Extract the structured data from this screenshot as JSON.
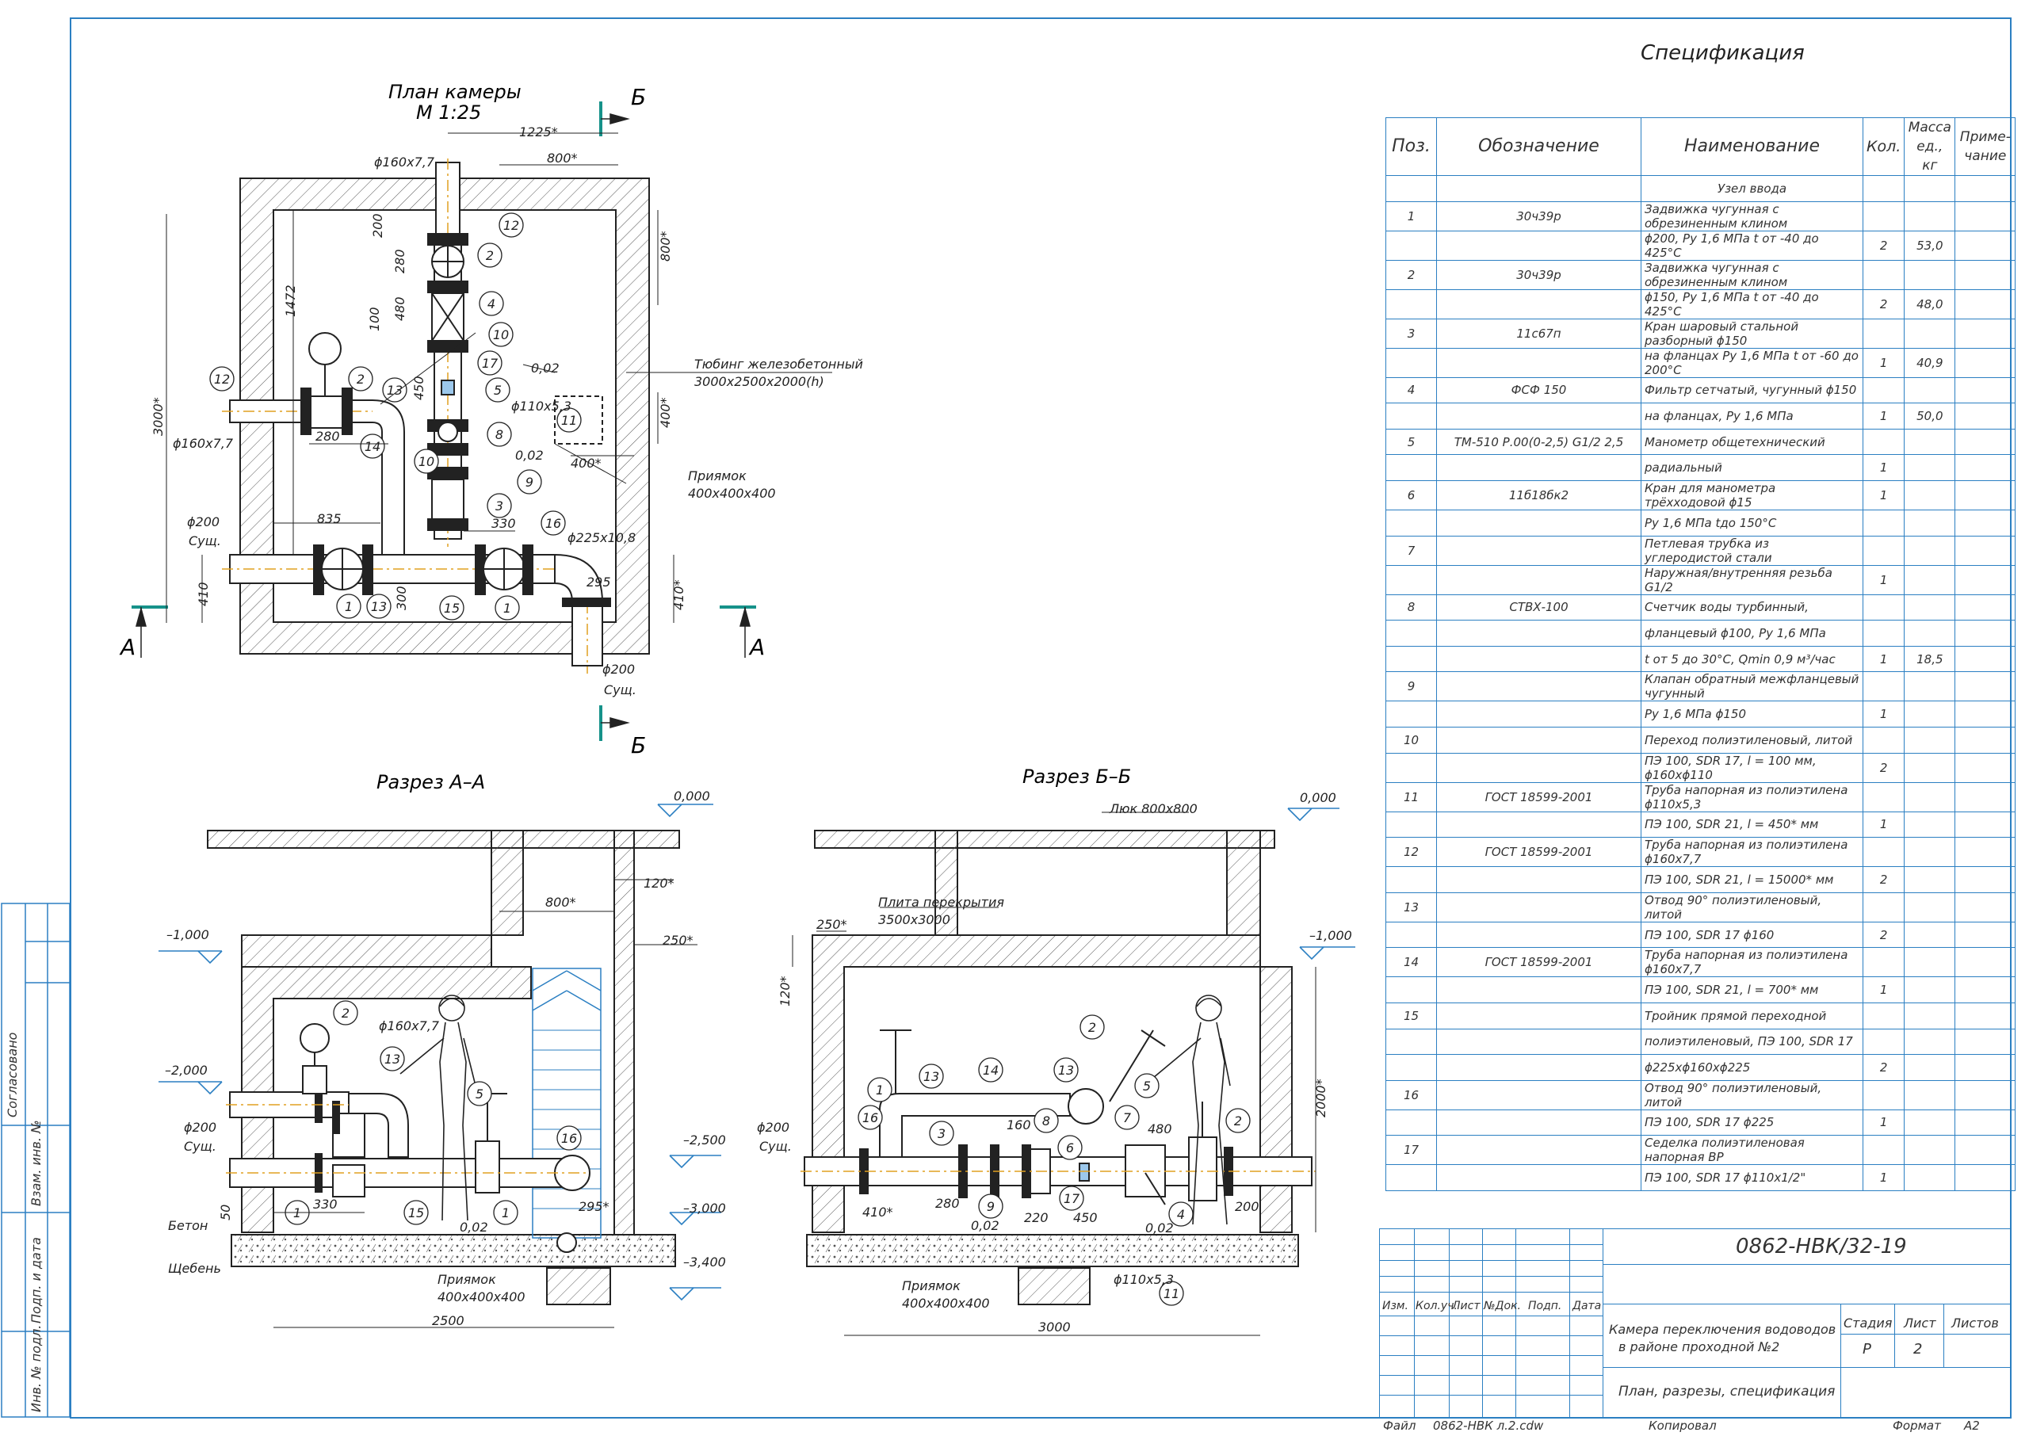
{
  "drawing": {
    "plan_title_1": "План камеры",
    "plan_title_2": "М 1:25",
    "section_aa": "Разрез А–А",
    "section_bb": "Разрез Б–Б",
    "cut_a": "А",
    "cut_b": "Б",
    "plan_labels": {
      "d160": "ϕ160x7,7",
      "d160b": "ϕ160x7,7",
      "d200": "ϕ200",
      "sush": "Сущ.",
      "d200b": "ϕ200",
      "sushb": "Сущ.",
      "d110": "ϕ110x5,3",
      "d225": "ϕ225x10,8",
      "tubing": "Тюбинг железобетонный",
      "tubing_size": "3000x2500x2000(h)",
      "pit": "Приямок",
      "pit_size": "400x400x400",
      "slope": "0,02",
      "slope2": "0,02",
      "dim_1225": "1225*",
      "dim_800": "800*",
      "dim_800v": "800*",
      "dim_400v": "400*",
      "dim_400h": "400*",
      "dim_410": "410",
      "dim_410r": "410*",
      "dim_3000": "3000*",
      "dim_1472": "1472",
      "dim_200": "200",
      "dim_280": "280",
      "dim_480": "480",
      "dim_100": "100",
      "dim_450": "450",
      "dim_280h": "280",
      "dim_330": "330",
      "dim_300": "300",
      "dim_295": "295",
      "dim_835": "835"
    },
    "aa_labels": {
      "l_0": "0,000",
      "l_m1": "–1,000",
      "l_m2": "–2,000",
      "l_m25": "–2,500",
      "l_m3": "–3,000",
      "l_m34": "–3,400",
      "d160": "ϕ160x7,7",
      "d200": "ϕ200",
      "sush": "Сущ.",
      "beton": "Бетон",
      "sheben": "Щебень",
      "pit": "Приямок",
      "pit_size": "400x400x400",
      "dim_800": "800*",
      "dim_120": "120*",
      "dim_250": "250*",
      "dim_330": "330",
      "dim_295": "295*",
      "dim_2500": "2500",
      "dim_50": "50",
      "slope": "0,02"
    },
    "bb_labels": {
      "l_0": "0,000",
      "l_m1": "–1,000",
      "hatch": "Люк 800х800",
      "slab": "Плита перекрытия",
      "slab_size": "3500х3000",
      "d200": "ϕ200",
      "sush": "Сущ.",
      "pit": "Приямок",
      "pit_size": "400x400x400",
      "d110": "ϕ110x5,3",
      "dim_250": "250*",
      "dim_120": "120*",
      "dim_2000": "2000*",
      "dim_410": "410*",
      "dim_280": "280",
      "dim_160": "160",
      "dim_220": "220",
      "dim_450": "450",
      "dim_480": "480",
      "dim_200": "200",
      "dim_3000": "3000",
      "slope": "0,02",
      "slope2": "0,02"
    },
    "pos_numbers": [
      "1",
      "2",
      "3",
      "4",
      "5",
      "6",
      "7",
      "8",
      "9",
      "10",
      "11",
      "12",
      "13",
      "14",
      "15",
      "16",
      "17"
    ]
  },
  "spec": {
    "title": "Спецификация",
    "headers": [
      "Поз.",
      "Обозначение",
      "Наименование",
      "Кол.",
      "Масса ед., кг",
      "Приме- чание"
    ],
    "rows": [
      [
        "",
        "",
        "Узел ввода",
        "",
        "",
        ""
      ],
      [
        "1",
        "30ч39р",
        "Задвижка чугунная с обрезиненным клином",
        "",
        "",
        ""
      ],
      [
        "",
        "",
        "ϕ200, Ру 1,6 МПа t от -40 до 425°С",
        "2",
        "53,0",
        ""
      ],
      [
        "2",
        "30ч39р",
        "Задвижка чугунная с обрезиненным клином",
        "",
        "",
        ""
      ],
      [
        "",
        "",
        "ϕ150, Ру 1,6 МПа t от -40 до 425°С",
        "2",
        "48,0",
        ""
      ],
      [
        "3",
        "11с67п",
        "Кран шаровый стальной разборный ϕ150",
        "",
        "",
        ""
      ],
      [
        "",
        "",
        "на фланцах Ру 1,6 МПа t от -60 до 200°С",
        "1",
        "40,9",
        ""
      ],
      [
        "4",
        "ФСФ 150",
        "Фильтр сетчатый, чугунный ϕ150",
        "",
        "",
        ""
      ],
      [
        "",
        "",
        "на фланцах, Ру 1,6 МПа",
        "1",
        "50,0",
        ""
      ],
      [
        "5",
        "ТМ-510 Р.00(0-2,5) G1/2 2,5",
        "Манометр общетехнический",
        "",
        "",
        ""
      ],
      [
        "",
        "",
        "радиальный",
        "1",
        "",
        ""
      ],
      [
        "6",
        "11б18бк2",
        "Кран для манометра трёхходовой ϕ15",
        "1",
        "",
        ""
      ],
      [
        "",
        "",
        "Ру 1,6 МПа tдо 150°С",
        "",
        "",
        ""
      ],
      [
        "7",
        "",
        "Петлевая трубка из углеродистой стали",
        "",
        "",
        ""
      ],
      [
        "",
        "",
        "Наружная/внутренняя резьба G1/2",
        "1",
        "",
        ""
      ],
      [
        "8",
        "СТВХ-100",
        "Счетчик воды турбинный,",
        "",
        "",
        ""
      ],
      [
        "",
        "",
        "фланцевый ϕ100, Ру 1,6 МПа",
        "",
        "",
        ""
      ],
      [
        "",
        "",
        "t от 5 до 30°С, Qmin 0,9 м³/час",
        "1",
        "18,5",
        ""
      ],
      [
        "9",
        "",
        "Клапан обратный межфланцевый чугунный",
        "",
        "",
        ""
      ],
      [
        "",
        "",
        "Ру 1,6 МПа                          ϕ150",
        "1",
        "",
        ""
      ],
      [
        "10",
        "",
        "Переход полиэтиленовый, литой",
        "",
        "",
        ""
      ],
      [
        "",
        "",
        "ПЭ 100, SDR 17, l = 100 мм, ϕ160xϕ110",
        "2",
        "",
        ""
      ],
      [
        "11",
        "ГОСТ 18599-2001",
        "Труба напорная из полиэтилена ϕ110x5,3",
        "",
        "",
        ""
      ],
      [
        "",
        "",
        "ПЭ 100, SDR 21, l = 450* мм",
        "1",
        "",
        ""
      ],
      [
        "12",
        "ГОСТ 18599-2001",
        "Труба напорная из полиэтилена ϕ160x7,7",
        "",
        "",
        ""
      ],
      [
        "",
        "",
        "ПЭ 100, SDR 21, l = 15000* мм",
        "2",
        "",
        ""
      ],
      [
        "13",
        "",
        "Отвод 90° полиэтиленовый, литой",
        "",
        "",
        ""
      ],
      [
        "",
        "",
        "ПЭ 100, SDR 17                      ϕ160",
        "2",
        "",
        ""
      ],
      [
        "14",
        "ГОСТ 18599-2001",
        "Труба напорная из полиэтилена ϕ160x7,7",
        "",
        "",
        ""
      ],
      [
        "",
        "",
        "ПЭ 100, SDR 21, l = 700* мм",
        "1",
        "",
        ""
      ],
      [
        "15",
        "",
        "Тройник прямой переходной",
        "",
        "",
        ""
      ],
      [
        "",
        "",
        "полиэтиленовый, ПЭ 100, SDR 17",
        "",
        "",
        ""
      ],
      [
        "",
        "",
        "ϕ225xϕ160xϕ225",
        "2",
        "",
        ""
      ],
      [
        "16",
        "",
        "Отвод 90° полиэтиленовый, литой",
        "",
        "",
        ""
      ],
      [
        "",
        "",
        "ПЭ 100, SDR 17                      ϕ225",
        "1",
        "",
        ""
      ],
      [
        "17",
        "",
        "Седелка полиэтиленовая напорная ВР",
        "",
        "",
        ""
      ],
      [
        "",
        "",
        "ПЭ 100, SDR 17               ϕ110x1/2\"",
        "1",
        "",
        ""
      ]
    ]
  },
  "title_block": {
    "code": "0862-НВК/32-19",
    "col_izm": "Изм.",
    "col_koluch": "Кол.уч.",
    "col_list": "Лист",
    "col_ndok": "№Док.",
    "col_podp": "Подп.",
    "col_data": "Дата",
    "object_1": "Камера переключения водоводов",
    "object_2": "в районе проходной №2",
    "stage_h": "Стадия",
    "sheet_h": "Лист",
    "sheets_h": "Листов",
    "stage": "Р",
    "sheet": "2",
    "sheets": "",
    "sheet_title": "План, разрезы, спецификация",
    "file_label": "Файл",
    "file_name": "0862-НВК л.2.cdw",
    "copied": "Копировал",
    "format_label": "Формат",
    "format": "А2"
  },
  "side_stamp": {
    "agreed": "Согласовано",
    "vzam": "Взам. инв. №",
    "podp_data": "Подп. и дата",
    "inv_podl": "Инв. № подл."
  },
  "colors": {
    "frame": "#2b7fc2",
    "line": "#222222",
    "hatch": "#555555",
    "ladder": "#2b7fc2",
    "accent_section": "#16928a"
  }
}
